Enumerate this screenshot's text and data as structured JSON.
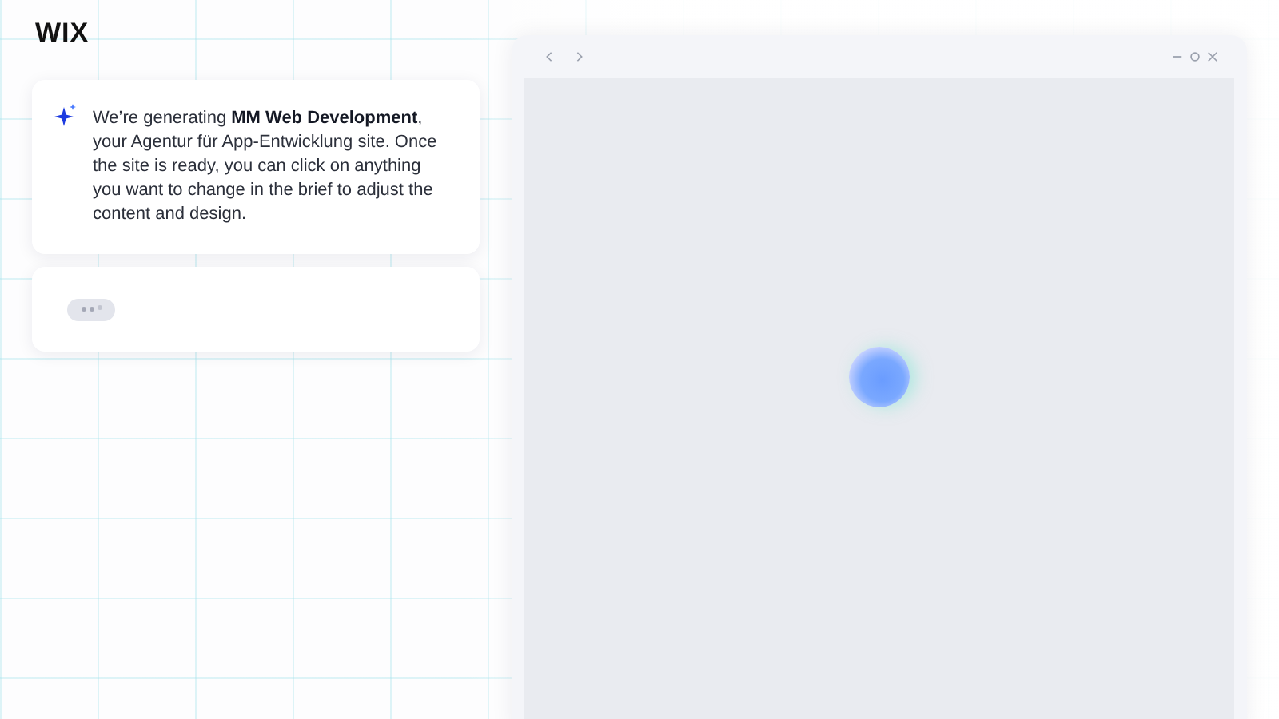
{
  "logo": "WIX",
  "chat": {
    "message": "We’re generating **MM Web Development**, your Agentur für App-Entwicklung site. Once the site is ready, you can click on anything you want to change in the brief to adjust the content and design.",
    "typing": true
  },
  "preview": {
    "loading": true
  }
}
